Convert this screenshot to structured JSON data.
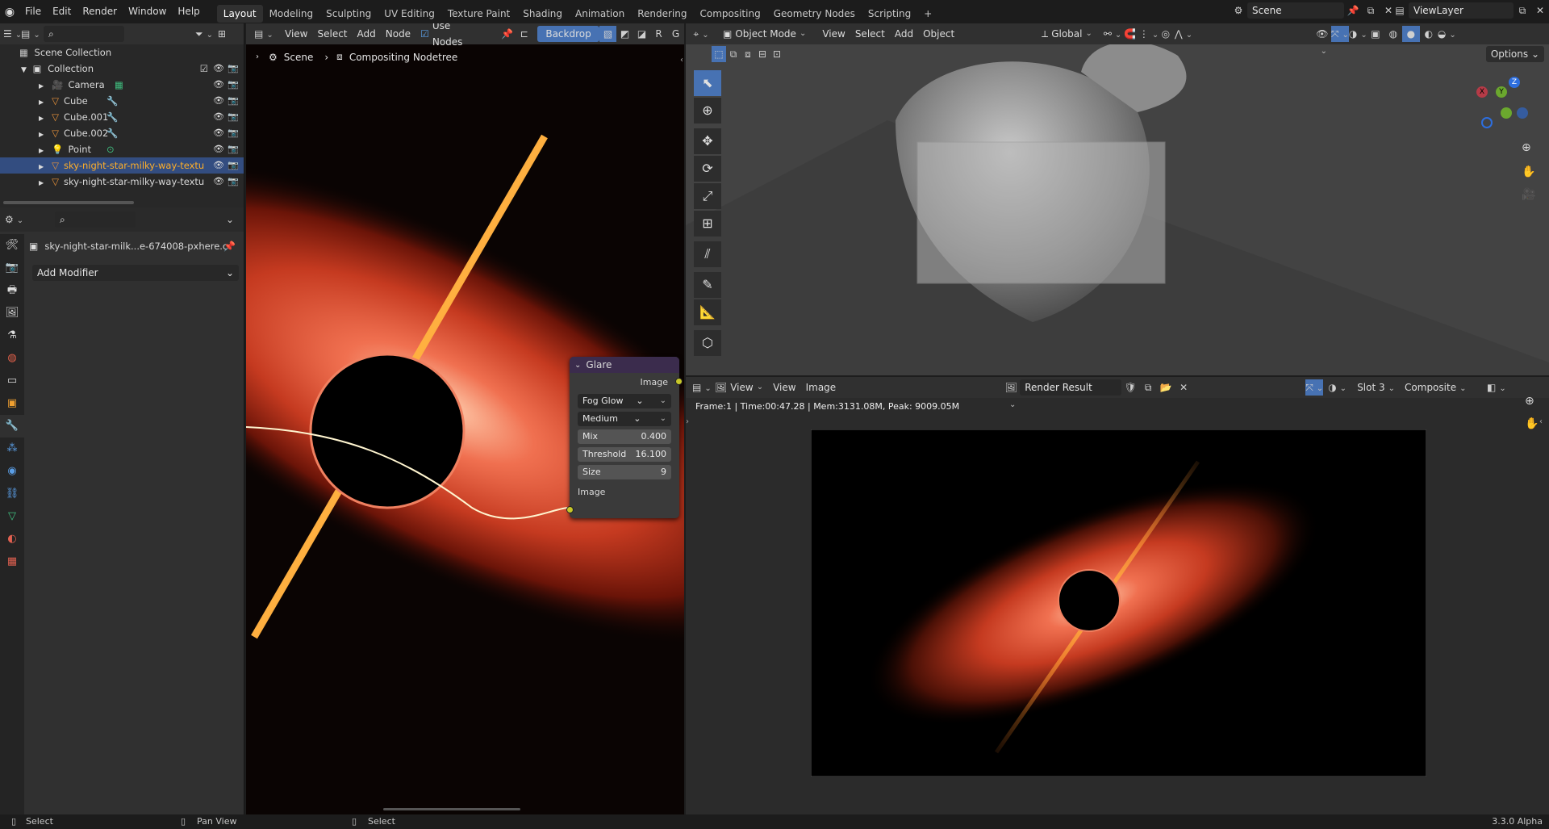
{
  "topbar": {
    "menus": [
      "File",
      "Edit",
      "Render",
      "Window",
      "Help"
    ],
    "workspaces": [
      "Layout",
      "Modeling",
      "Sculpting",
      "UV Editing",
      "Texture Paint",
      "Shading",
      "Animation",
      "Rendering",
      "Compositing",
      "Geometry Nodes",
      "Scripting"
    ],
    "active_workspace": "Layout",
    "add_tab": "+",
    "scene": "Scene",
    "view_layer": "ViewLayer"
  },
  "outliner": {
    "root": "Scene Collection",
    "collection": "Collection",
    "items": [
      {
        "name": "Camera",
        "icon": "camera-icon",
        "selected": false
      },
      {
        "name": "Cube",
        "icon": "mesh-icon",
        "selected": false
      },
      {
        "name": "Cube.001",
        "icon": "mesh-icon",
        "selected": false
      },
      {
        "name": "Cube.002",
        "icon": "mesh-icon",
        "selected": false
      },
      {
        "name": "Point",
        "icon": "light-icon",
        "selected": false
      },
      {
        "name": "sky-night-star-milky-way-textu",
        "icon": "mesh-icon",
        "selected": true
      },
      {
        "name": "sky-night-star-milky-way-textu",
        "icon": "mesh-icon",
        "selected": false
      }
    ]
  },
  "properties": {
    "object_name": "sky-night-star-milk...e-674008-pxhere.c",
    "add_modifier": "Add Modifier"
  },
  "node_editor": {
    "header": {
      "menus": [
        "View",
        "Select",
        "Add",
        "Node"
      ],
      "use_nodes": "Use Nodes",
      "backdrop": "Backdrop",
      "channels": [
        "R",
        "G"
      ]
    },
    "breadcrumb": {
      "scene": "Scene",
      "tree": "Compositing Nodetree"
    },
    "glare_node": {
      "title": "Glare",
      "output_socket": "Image",
      "glare_type": "Fog Glow",
      "quality": "Medium",
      "mix_label": "Mix",
      "mix_value": "0.400",
      "threshold_label": "Threshold",
      "threshold_value": "16.100",
      "size_label": "Size",
      "size_value": "9",
      "input_socket": "Image"
    }
  },
  "viewport": {
    "mode": "Object Mode",
    "menus": [
      "View",
      "Select",
      "Add",
      "Object"
    ],
    "orientation": "Global",
    "options": "Options",
    "gizmo_axes": [
      "X",
      "Y",
      "Z"
    ]
  },
  "image_editor": {
    "menus": [
      "View",
      "View",
      "Image"
    ],
    "image_name": "Render Result",
    "slot": "Slot 3",
    "layer": "Composite",
    "render_info": "Frame:1 | Time:00:47.28 | Mem:3131.08M, Peak: 9009.05M"
  },
  "statusbar": {
    "left": "Select",
    "middle": "Pan View",
    "right": "Select",
    "version": "3.3.0 Alpha"
  },
  "colors": {
    "accent": "#4772b3",
    "selected_text": "#ffaf29",
    "glare_header": "#3b2c4d"
  }
}
